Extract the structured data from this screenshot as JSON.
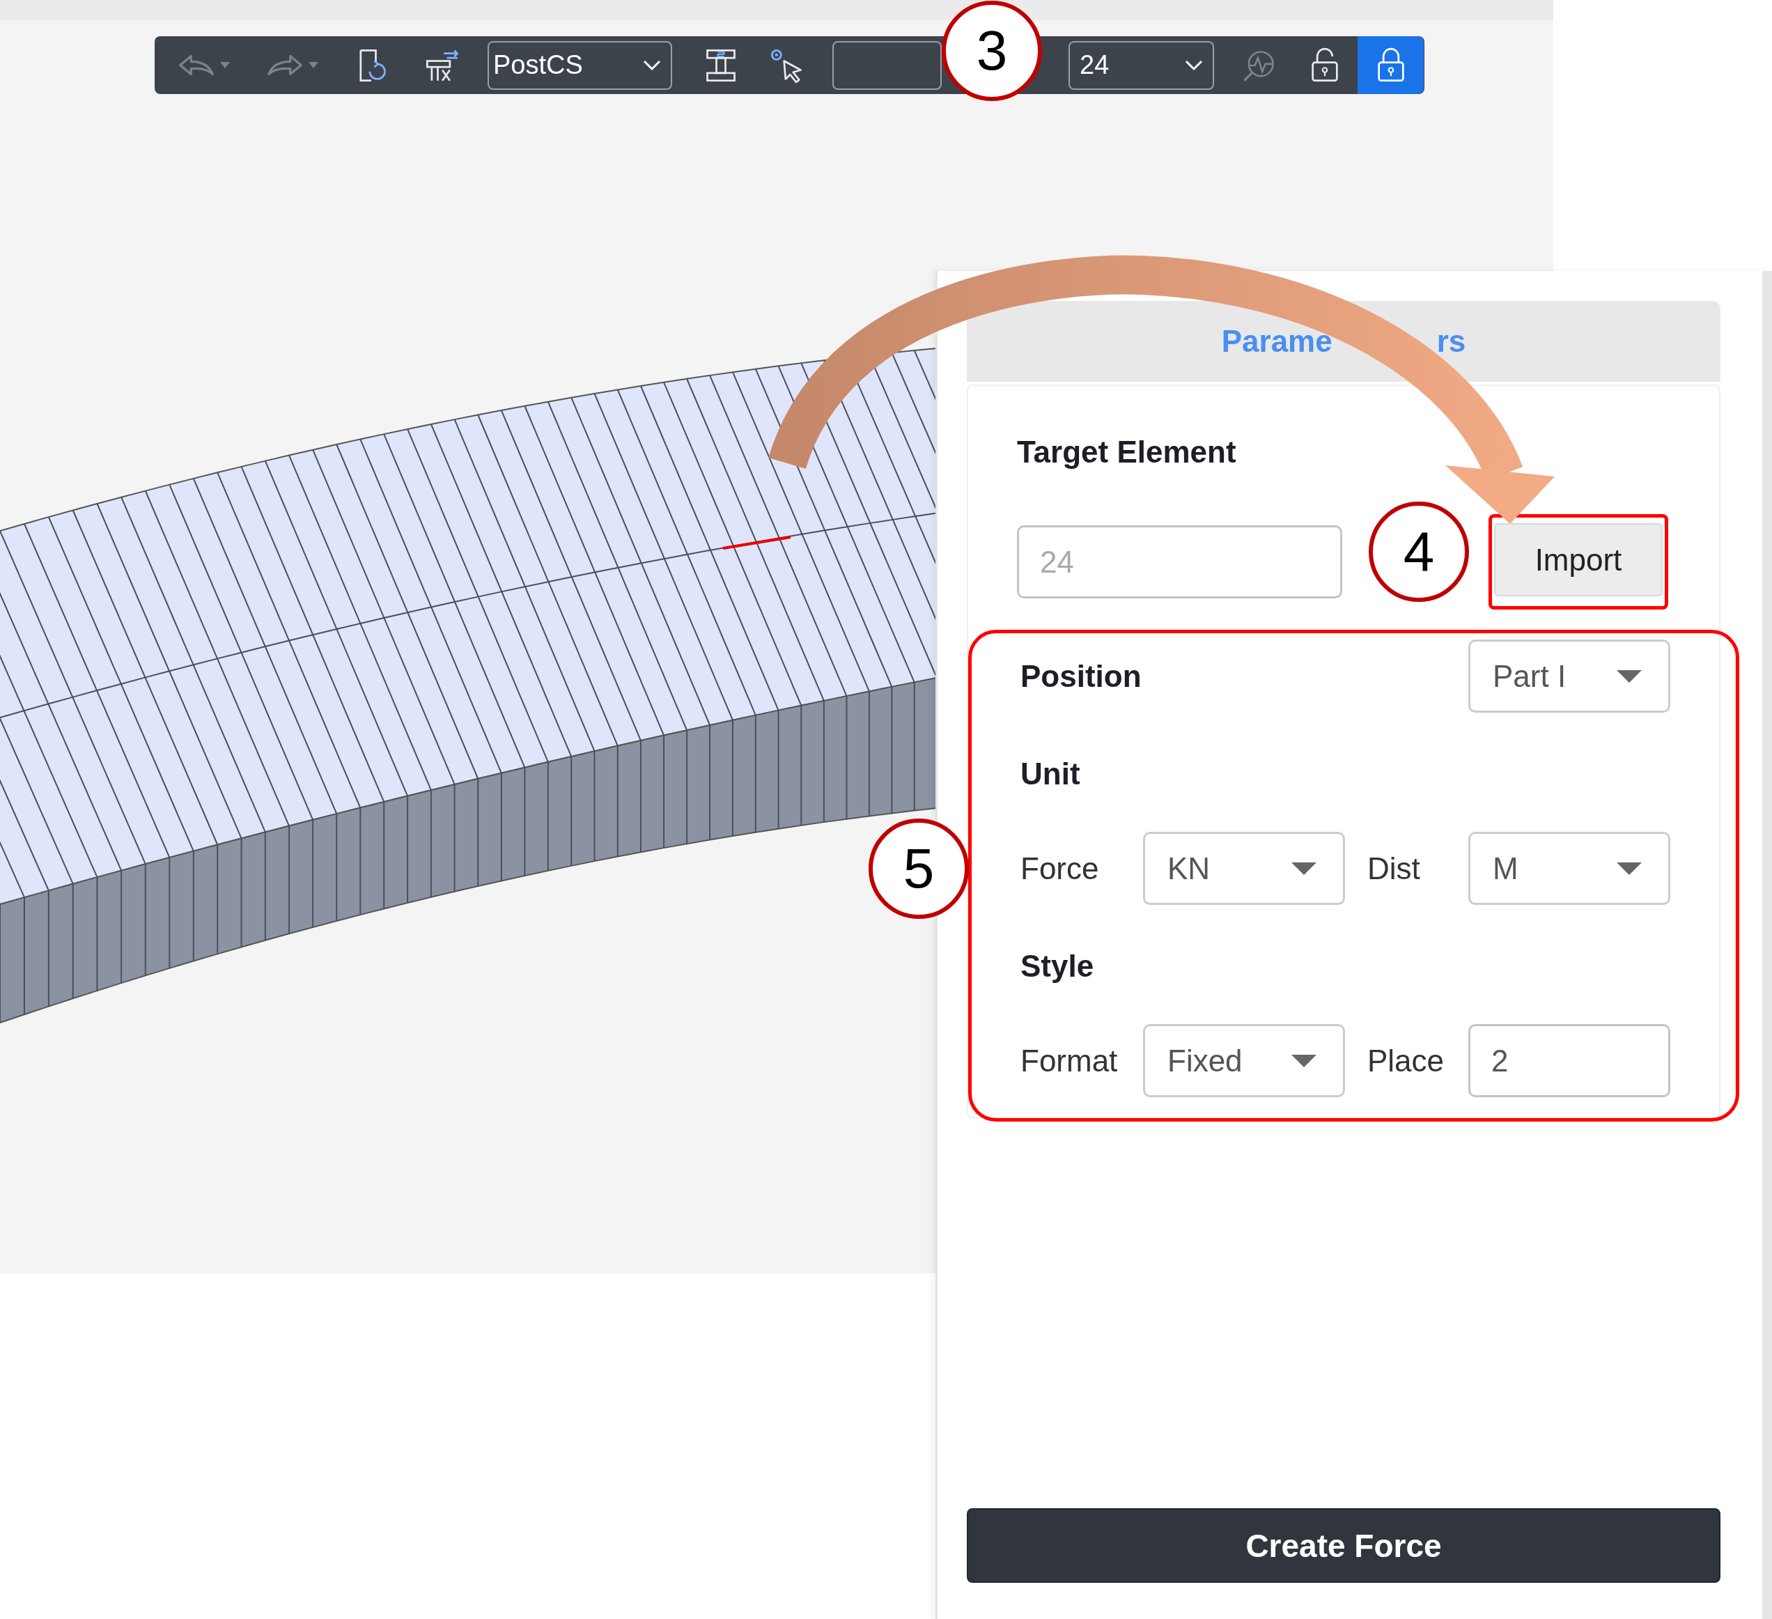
{
  "toolbar": {
    "items": [
      {
        "kind": "icon_button",
        "disabled": true,
        "menu": true,
        "on": false
      },
      {
        "kind": "icon_button",
        "disabled": true,
        "menu": true,
        "on": false
      },
      {
        "kind": "icon_button",
        "disabled": false,
        "menu": false,
        "on": false
      },
      {
        "kind": "icon_button",
        "disabled": false,
        "menu": false,
        "on": false
      },
      {
        "kind": "dropdown",
        "value": "PostCS"
      },
      {
        "kind": "icon_button",
        "disabled": false,
        "menu": false,
        "on": false
      },
      {
        "kind": "icon_button",
        "disabled": false,
        "menu": false,
        "on": false
      },
      {
        "kind": "field"
      },
      {
        "kind": "dropdown",
        "value": "24"
      },
      {
        "kind": "icon_button",
        "disabled": true,
        "menu": false,
        "on": false
      },
      {
        "kind": "icon_button",
        "disabled": false,
        "menu": false,
        "on": false
      },
      {
        "kind": "icon_button",
        "disabled": false,
        "menu": false,
        "on": true
      }
    ]
  },
  "panel": {
    "tab": {
      "label_start": "Parame",
      "label_end": "rs",
      "selected": true
    },
    "target_element": {
      "label": "Target Element",
      "placeholder": "24",
      "button": "Import"
    },
    "position": {
      "label": "Position",
      "value": "Part I"
    },
    "unit": {
      "heading": "Unit",
      "force": {
        "label": "Force",
        "value": "KN"
      },
      "dist": {
        "label": "Dist",
        "value": "M"
      }
    },
    "style": {
      "heading": "Style",
      "format": {
        "label": "Format",
        "value": "Fixed"
      },
      "place": {
        "label": "Place",
        "value": "2"
      }
    },
    "create_button": "Create Force"
  },
  "callouts": [
    {
      "label": "3"
    },
    {
      "label": "4"
    },
    {
      "label": "5"
    }
  ]
}
